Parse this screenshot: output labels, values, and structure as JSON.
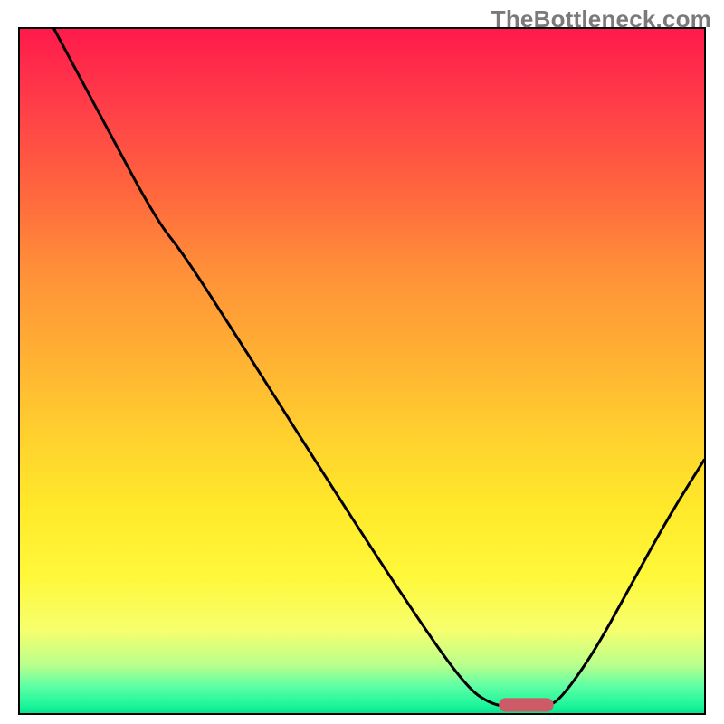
{
  "watermark": "TheBottleneck.com",
  "chart_data": {
    "type": "line",
    "title": "",
    "xlabel": "",
    "ylabel": "",
    "xlim": [
      0,
      100
    ],
    "ylim": [
      0,
      100
    ],
    "curve": [
      {
        "x": 5.0,
        "y": 100.0
      },
      {
        "x": 13.0,
        "y": 85.0
      },
      {
        "x": 20.0,
        "y": 72.0
      },
      {
        "x": 24.0,
        "y": 67.0
      },
      {
        "x": 33.0,
        "y": 53.0
      },
      {
        "x": 45.0,
        "y": 34.0
      },
      {
        "x": 56.0,
        "y": 17.0
      },
      {
        "x": 65.0,
        "y": 4.0
      },
      {
        "x": 69.0,
        "y": 1.2
      },
      {
        "x": 72.0,
        "y": 1.0
      },
      {
        "x": 77.0,
        "y": 1.0
      },
      {
        "x": 79.0,
        "y": 2.0
      },
      {
        "x": 84.0,
        "y": 9.0
      },
      {
        "x": 90.0,
        "y": 20.0
      },
      {
        "x": 95.0,
        "y": 29.0
      },
      {
        "x": 100.0,
        "y": 37.0
      }
    ],
    "optimum_marker": {
      "x_start": 70.0,
      "x_end": 78.0,
      "y": 1.2
    },
    "gradient_stops": [
      {
        "pct": 0,
        "color": "#ff1a4b"
      },
      {
        "pct": 25,
        "color": "#ff6a3d"
      },
      {
        "pct": 50,
        "color": "#ffc030"
      },
      {
        "pct": 75,
        "color": "#ffe92a"
      },
      {
        "pct": 90,
        "color": "#dfff70"
      },
      {
        "pct": 100,
        "color": "#0be08f"
      }
    ]
  }
}
